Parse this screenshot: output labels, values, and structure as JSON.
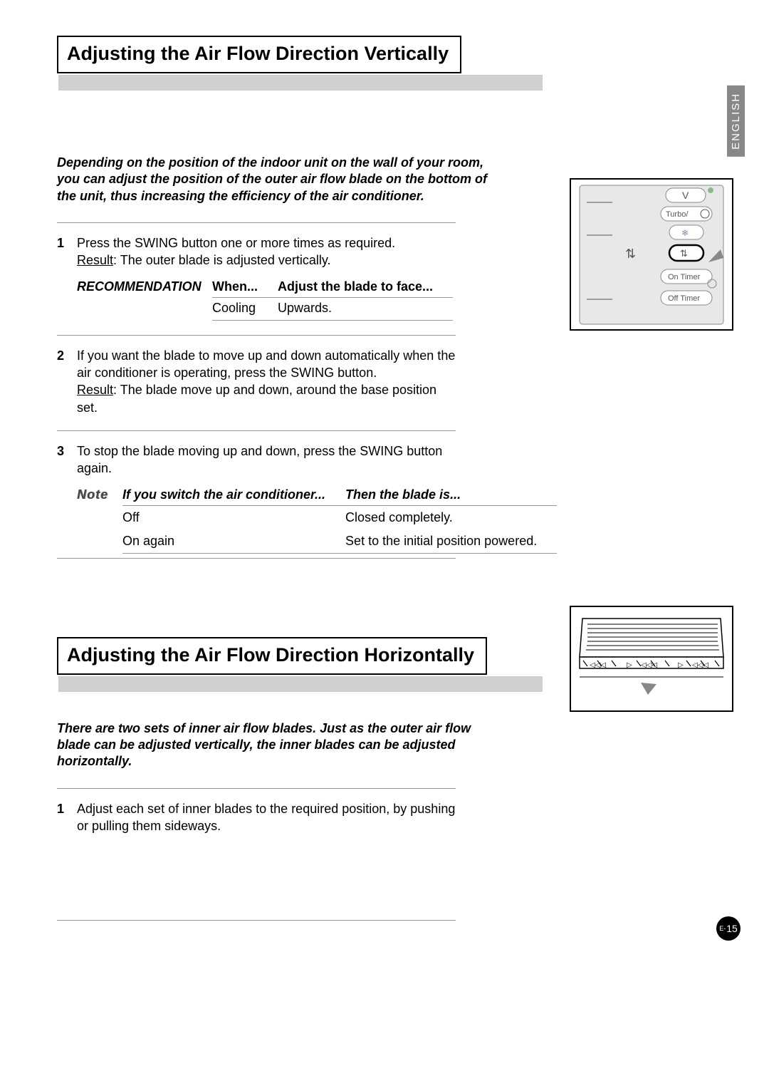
{
  "language_tab": "ENGLISH",
  "page_number_prefix": "E-",
  "page_number": "15",
  "section1": {
    "title": "Adjusting the Air Flow Direction Vertically",
    "intro": "Depending on the position of the indoor unit on the wall of your room, you can adjust the position of the outer air flow blade on the bottom of the unit, thus increasing the efficiency of the air conditioner.",
    "steps": {
      "s1_num": "1",
      "s1_text": "Press the SWING button one or more times as required.",
      "s1_result_label": "Result",
      "s1_result_text": ": The outer blade is adjusted vertically.",
      "rec_label": "RECOMMENDATION",
      "rec_h1": "When...",
      "rec_h2": "Adjust the blade to face...",
      "rec_c1": "Cooling",
      "rec_c2": "Upwards.",
      "s2_num": "2",
      "s2_text": "If you want the blade to move up and down automatically when the air conditioner is operating, press the SWING button.",
      "s2_result_label": "Result",
      "s2_result_text": ": The blade move up and down, around the base position set.",
      "s3_num": "3",
      "s3_text": "To stop the blade moving up and down, press the SWING button again.",
      "note_label": "Note",
      "note_h1": "If you switch the air conditioner...",
      "note_h2": "Then the blade is...",
      "note_r1c1": "Off",
      "note_r1c2": "Closed completely.",
      "note_r2c1": "On again",
      "note_r2c2": "Set to the initial position powered."
    },
    "remote": {
      "btn_turbo": "Turbo/",
      "btn_on_timer": "On Timer",
      "btn_off_timer": "Off Timer"
    }
  },
  "section2": {
    "title": "Adjusting the Air Flow Direction Horizontally",
    "intro": "There are two sets of inner air flow blades. Just as the outer air flow blade can be adjusted vertically, the inner blades can be adjusted horizontally.",
    "s1_num": "1",
    "s1_text": "Adjust each set of inner blades to the required position, by pushing or pulling them sideways."
  }
}
